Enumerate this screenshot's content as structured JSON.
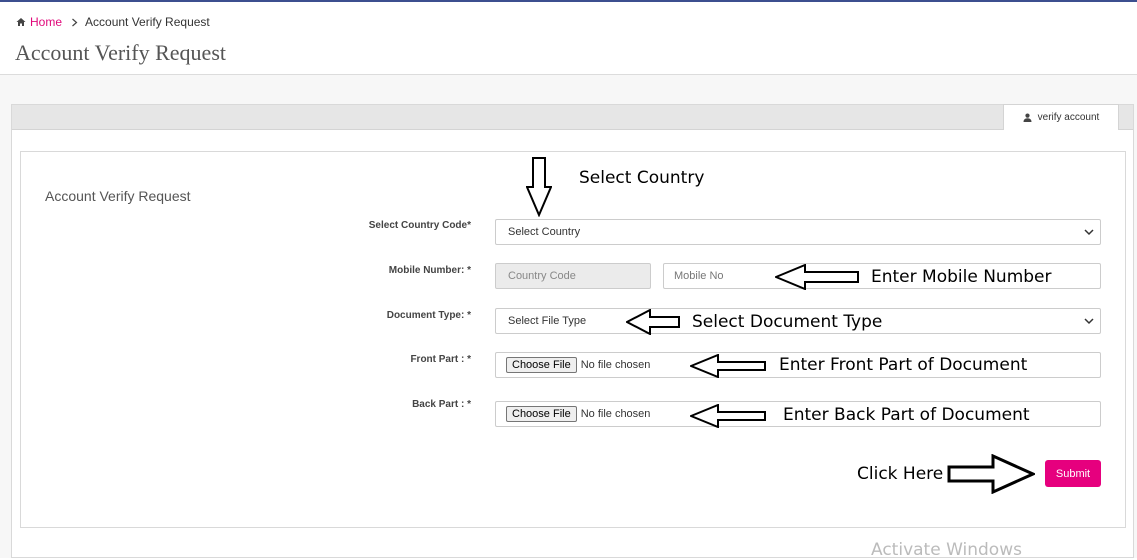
{
  "breadcrumb": {
    "home": "Home",
    "current": "Account Verify Request"
  },
  "page_title": "Account Verify Request",
  "tab": {
    "label": "verify account"
  },
  "form": {
    "heading": "Account Verify Request",
    "country": {
      "label": "Select Country Code*",
      "value": "Select Country"
    },
    "mobile": {
      "label": "Mobile Number: *",
      "code_placeholder": "Country Code",
      "number_placeholder": "Mobile No"
    },
    "document_type": {
      "label": "Document Type: *",
      "value": "Select File Type"
    },
    "front": {
      "label": "Front Part : *",
      "button": "Choose File",
      "status": "No file chosen"
    },
    "back": {
      "label": "Back Part : *",
      "button": "Choose File",
      "status": "No file chosen"
    },
    "submit": "Submit"
  },
  "annotations": {
    "country": "Select Country",
    "mobile": "Enter Mobile Number",
    "doc_type": "Select Document Type",
    "front": "Enter Front Part of Document",
    "back": "Enter Back Part of Document",
    "submit": "Click Here"
  },
  "watermark": "Activate Windows",
  "colors": {
    "accent": "#e6007e",
    "link": "#e0087a",
    "topline": "#3c4f8f"
  },
  "icons": [
    "home-icon",
    "chevron-right-icon",
    "user-icon",
    "chevron-down-icon",
    "arrow-down-icon",
    "arrow-left-icon",
    "arrow-right-icon"
  ]
}
